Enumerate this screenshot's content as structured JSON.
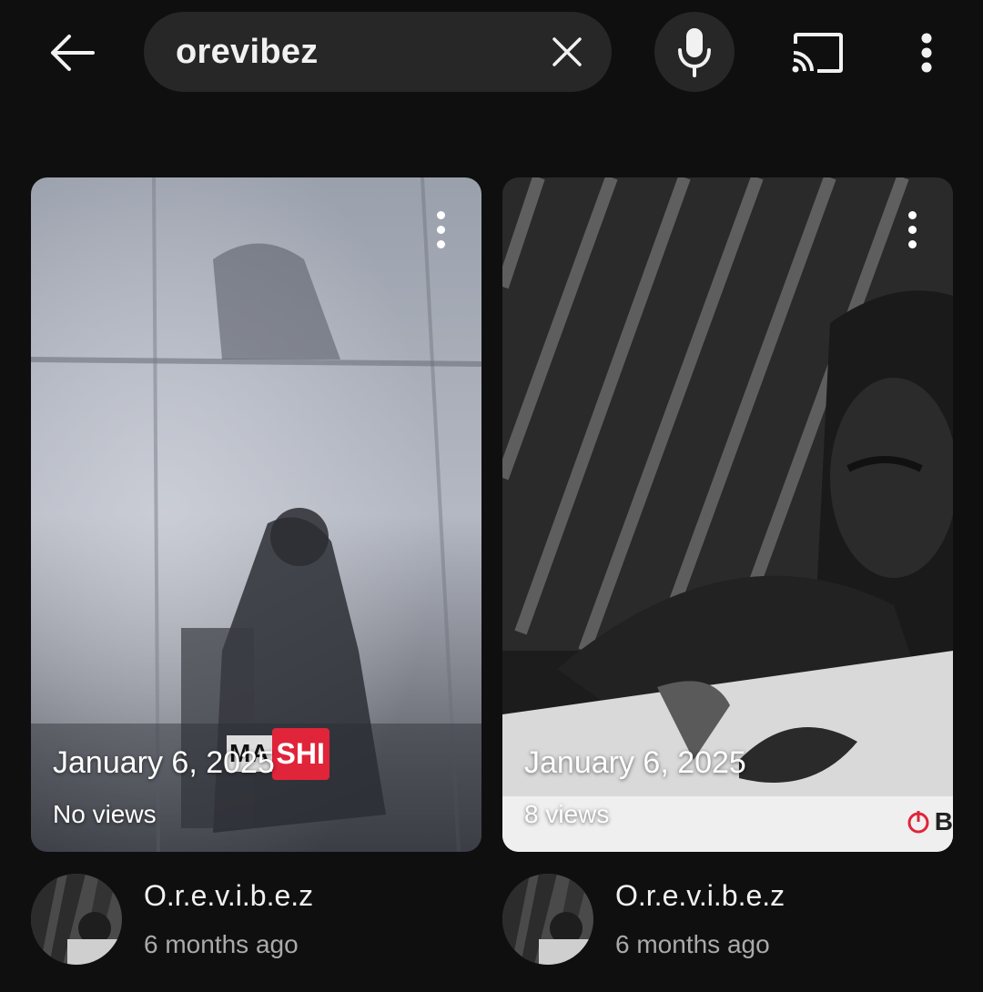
{
  "search": {
    "query": "orevibez"
  },
  "icons": {
    "back": "arrow-left-icon",
    "clear": "close-icon",
    "mic": "microphone-icon",
    "cast": "cast-icon",
    "more": "more-vert-icon"
  },
  "colors": {
    "background": "#0f0f0f",
    "surface": "#272727",
    "text": "#f1f1f1",
    "secondary_text": "#aaaaaa",
    "sticker_red": "#e0243a"
  },
  "results": [
    {
      "date": "January 6, 2025",
      "views": "No views",
      "channel": "O.r.e.v.i.b.e.z",
      "age": "6 months ago",
      "sticker": {
        "left": "MA",
        "right": "SHI"
      }
    },
    {
      "date": "January 6, 2025",
      "views": "8 views",
      "channel": "O.r.e.v.i.b.e.z",
      "age": "6 months ago",
      "watermark": "B"
    }
  ]
}
